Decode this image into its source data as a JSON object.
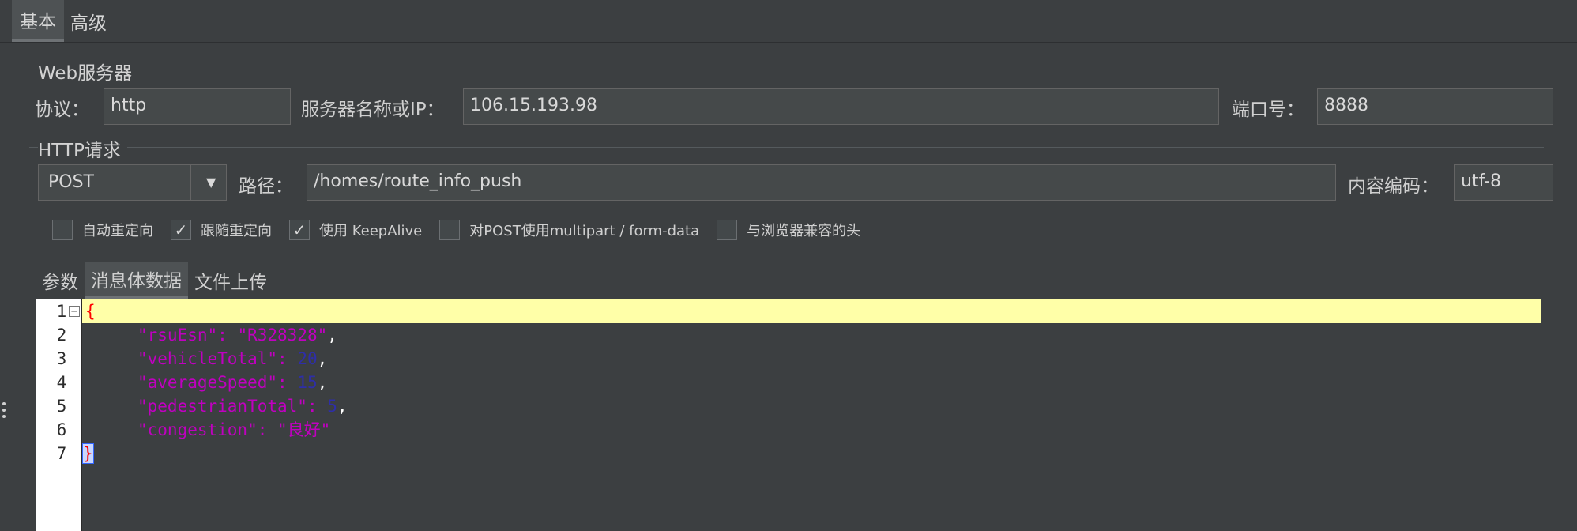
{
  "top_tabs": [
    {
      "label": "基本",
      "active": true
    },
    {
      "label": "高级",
      "active": false
    }
  ],
  "web_server": {
    "section_title": "Web服务器",
    "protocol_label": "协议：",
    "protocol_value": "http",
    "server_label": "服务器名称或IP：",
    "server_value": "106.15.193.98",
    "port_label": "端口号：",
    "port_value": "8888"
  },
  "http_request": {
    "section_title": "HTTP请求",
    "method_value": "POST",
    "path_label": "路径：",
    "path_value": "/homes/route_info_push",
    "encoding_label": "内容编码：",
    "encoding_value": "utf-8"
  },
  "options": [
    {
      "label": "自动重定向",
      "checked": false
    },
    {
      "label": "跟随重定向",
      "checked": true
    },
    {
      "label": "使用 KeepAlive",
      "checked": true
    },
    {
      "label": "对POST使用multipart / form-data",
      "checked": false
    },
    {
      "label": "与浏览器兼容的头",
      "checked": false
    }
  ],
  "body_tabs": [
    {
      "label": "参数",
      "active": false
    },
    {
      "label": "消息体数据",
      "active": true
    },
    {
      "label": "文件上传",
      "active": false
    }
  ],
  "editor": {
    "line_numbers": [
      "1",
      "2",
      "3",
      "4",
      "5",
      "6",
      "7"
    ],
    "open_brace": "{",
    "close_brace": "}",
    "entries": [
      {
        "key": "\"rsuEsn\"",
        "sep": ": ",
        "value": "\"R328328\"",
        "value_type": "string",
        "trail": ","
      },
      {
        "key": "\"vehicleTotal\"",
        "sep": ": ",
        "value": "20",
        "value_type": "number",
        "trail": ","
      },
      {
        "key": "\"averageSpeed\"",
        "sep": ": ",
        "value": "15",
        "value_type": "number",
        "trail": ","
      },
      {
        "key": "\"pedestrianTotal\"",
        "sep": ": ",
        "value": "5",
        "value_type": "number",
        "trail": ","
      },
      {
        "key": "\"congestion\"",
        "sep": ": ",
        "value": "\"良好\"",
        "value_type": "string",
        "trail": ""
      }
    ]
  },
  "icons": {
    "dropdown": "chevron-down-icon",
    "fold": "fold-minus-icon",
    "checkmark": "✓"
  }
}
